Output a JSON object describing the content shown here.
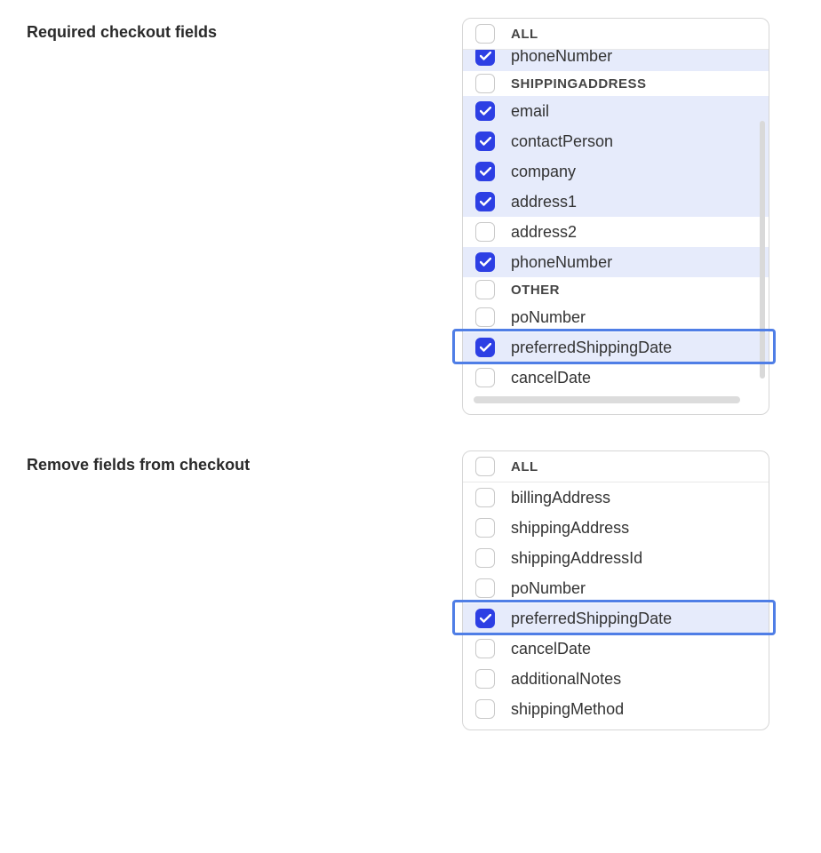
{
  "required": {
    "label": "Required checkout fields",
    "all_label": "ALL",
    "clipped_item": {
      "label": "phoneNumber",
      "checked": true,
      "selected": true
    },
    "group_shipping": {
      "label": "SHIPPINGADDRESS",
      "checked": false
    },
    "items": [
      {
        "key": "email",
        "label": "email",
        "checked": true,
        "selected": true,
        "highlighted": false
      },
      {
        "key": "contactPerson",
        "label": "contactPerson",
        "checked": true,
        "selected": true,
        "highlighted": false
      },
      {
        "key": "company",
        "label": "company",
        "checked": true,
        "selected": true,
        "highlighted": false
      },
      {
        "key": "address1",
        "label": "address1",
        "checked": true,
        "selected": true,
        "highlighted": false
      },
      {
        "key": "address2",
        "label": "address2",
        "checked": false,
        "selected": false,
        "highlighted": false
      },
      {
        "key": "phoneNumber",
        "label": "phoneNumber",
        "checked": true,
        "selected": true,
        "highlighted": false
      }
    ],
    "group_other": {
      "label": "OTHER",
      "checked": false
    },
    "items_other": [
      {
        "key": "poNumber",
        "label": "poNumber",
        "checked": false,
        "selected": false,
        "highlighted": false
      },
      {
        "key": "preferredShippingDate",
        "label": "preferredShippingDate",
        "checked": true,
        "selected": true,
        "highlighted": true
      },
      {
        "key": "cancelDate",
        "label": "cancelDate",
        "checked": false,
        "selected": false,
        "highlighted": false
      }
    ]
  },
  "remove": {
    "label": "Remove fields from checkout",
    "all_label": "ALL",
    "items": [
      {
        "key": "billingAddress",
        "label": "billingAddress",
        "checked": false,
        "selected": false,
        "highlighted": false
      },
      {
        "key": "shippingAddress",
        "label": "shippingAddress",
        "checked": false,
        "selected": false,
        "highlighted": false
      },
      {
        "key": "shippingAddressId",
        "label": "shippingAddressId",
        "checked": false,
        "selected": false,
        "highlighted": false
      },
      {
        "key": "poNumber",
        "label": "poNumber",
        "checked": false,
        "selected": false,
        "highlighted": false
      },
      {
        "key": "preferredShippingDate",
        "label": "preferredShippingDate",
        "checked": true,
        "selected": true,
        "highlighted": true
      },
      {
        "key": "cancelDate",
        "label": "cancelDate",
        "checked": false,
        "selected": false,
        "highlighted": false
      },
      {
        "key": "additionalNotes",
        "label": "additionalNotes",
        "checked": false,
        "selected": false,
        "highlighted": false
      },
      {
        "key": "shippingMethod",
        "label": "shippingMethod",
        "checked": false,
        "selected": false,
        "highlighted": false
      }
    ]
  }
}
